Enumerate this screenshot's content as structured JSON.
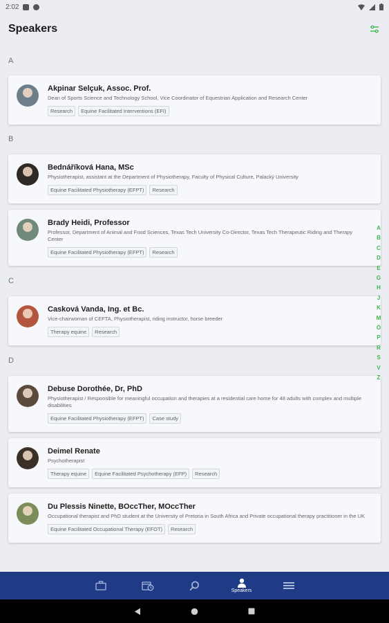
{
  "status_bar": {
    "time": "2:02"
  },
  "header": {
    "title": "Speakers",
    "filter_icon": "filter-sliders-icon"
  },
  "sections": [
    {
      "letter": "A",
      "speakers": [
        {
          "name": "Akpinar Selçuk, Assoc. Prof.",
          "description": "Dean of Sports Science and Technology School, Vice Coordinator of Equestrian Application and Research Center",
          "tags": [
            "Research",
            "Equine Facilitated Interventions (EFI)"
          ],
          "avatar_color": "#6e7f8c"
        }
      ]
    },
    {
      "letter": "B",
      "speakers": [
        {
          "name": "Bednáříková Hana, MSc",
          "description": "Physiotherapist, assistant at the Department of Physiotherapy, Faculty of Physical Culture, Palacký University",
          "tags": [
            "Equine Facilitated Physiotherapy (EFPT)",
            "Research"
          ],
          "avatar_color": "#2f2a26"
        },
        {
          "name": "Brady Heidi, Professor",
          "description": "Professor, Department of Animal and Food Sciences, Texas Tech University Co-Director, Texas Tech Therapeutic Riding and Therapy Center",
          "tags": [
            "Equine Facilitated Physiotherapy (EFPT)",
            "Research"
          ],
          "avatar_color": "#6f8a7a"
        }
      ]
    },
    {
      "letter": "C",
      "speakers": [
        {
          "name": "Casková Vanda, Ing. et Bc.",
          "description": "Vice-chairwoman of CEFTA, Physiotherapist, riding instructor, horse breeder",
          "tags": [
            "Therapy equine",
            "Research"
          ],
          "avatar_color": "#b4553f"
        }
      ]
    },
    {
      "letter": "D",
      "speakers": [
        {
          "name": "Debuse Dorothée, Dr, PhD",
          "description": "Physiotherapist / Responsible for meaningful occupation and therapies at a residential care home for 48 adults with complex and multiple disabilities",
          "tags": [
            "Equine Facilitated Physiotherapy (EFPT)",
            "Case study"
          ],
          "avatar_color": "#5a4a3c"
        },
        {
          "name": "Deimel Renate",
          "description": "Psychotherapist",
          "tags": [
            "Therapy equine",
            "Equine Facilitated Psychotherapy (EFP)",
            "Research"
          ],
          "avatar_color": "#3a3028"
        },
        {
          "name": "Du Plessis Ninette, BOccTher, MOccTher",
          "description": "Occupational therapist and PhD student at the University of Pretoria in South Africa and Private occupational therapy practitioner in the UK",
          "tags": [
            "Equine Facilitated Occupational Therapy (EFOT)",
            "Research"
          ],
          "avatar_color": "#7c8c5a"
        }
      ]
    }
  ],
  "alphabet_index": [
    "A",
    "B",
    "C",
    "D",
    "E",
    "G",
    "H",
    "J",
    "K",
    "M",
    "Ö",
    "P",
    "R",
    "S",
    "V",
    "Z"
  ],
  "bottom_nav": {
    "items": [
      {
        "icon": "briefcase-icon",
        "label": ""
      },
      {
        "icon": "calendar-clock-icon",
        "label": ""
      },
      {
        "icon": "search-icon",
        "label": ""
      },
      {
        "icon": "person-icon",
        "label": "Speakers"
      },
      {
        "icon": "menu-icon",
        "label": ""
      }
    ]
  },
  "colors": {
    "nav_background": "#1f3b86",
    "index_accent": "#3bb54a"
  }
}
